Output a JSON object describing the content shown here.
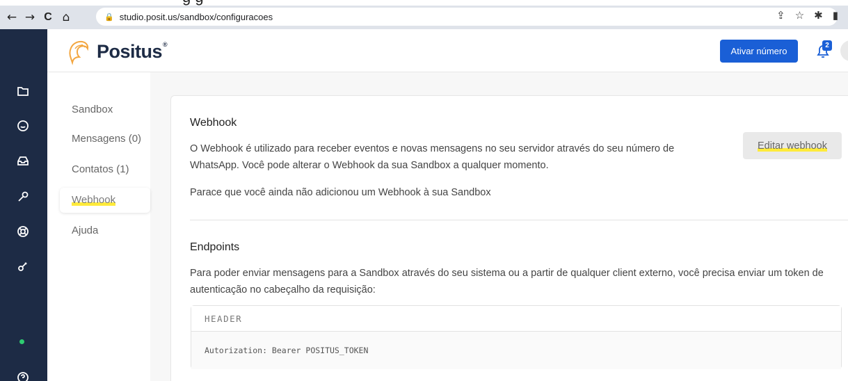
{
  "caption_fragment": "g                                                      g",
  "browser": {
    "back": "←",
    "forward": "→",
    "reload": "C",
    "home": "⌂",
    "url": "studio.posit.us/sandbox/configuracoes"
  },
  "header": {
    "logo": "Positus",
    "logo_reg": "®",
    "activate_button": "Ativar número",
    "notification_count": "2"
  },
  "sidebar": {
    "items": [
      {
        "label": "Sandbox"
      },
      {
        "label": "Mensagens (0)"
      },
      {
        "label": "Contatos (1)"
      },
      {
        "label": "Webhook"
      },
      {
        "label": "Ajuda"
      }
    ]
  },
  "webhook": {
    "title": "Webhook",
    "description_line1": "O Webhook é utilizado para receber eventos e novas mensagens no seu servidor através do seu número de",
    "description_line2": "WhatsApp. Você pode alterar o Webhook da sua Sandbox a qualquer momento.",
    "empty_notice": "Parace que você ainda não adicionou um Webhook à sua Sandbox",
    "edit_button": "Editar webhook"
  },
  "endpoints": {
    "title": "Endpoints",
    "description_line1": "Para poder enviar mensagens para a Sandbox através do seu sistema ou a partir de qualquer client externo, você precisa enviar um token de",
    "description_line2": "autenticação no cabeçalho da requisição:",
    "code_header": "HEADER",
    "code_line": "Autorization: Bearer POSITUS_TOKEN"
  },
  "colors": {
    "rail": "#1d2b45",
    "accent": "#1a5fd6",
    "highlight": "#ffeb3b",
    "status_dot": "#2ecc71"
  },
  "icons": [
    "folder-icon",
    "chat-icon",
    "inbox-icon",
    "wrench-icon",
    "lifebuoy-icon",
    "key-icon",
    "help-icon",
    "bell-icon",
    "lock-icon",
    "share-icon",
    "star-icon",
    "extension-icon",
    "sidepanel-icon"
  ]
}
